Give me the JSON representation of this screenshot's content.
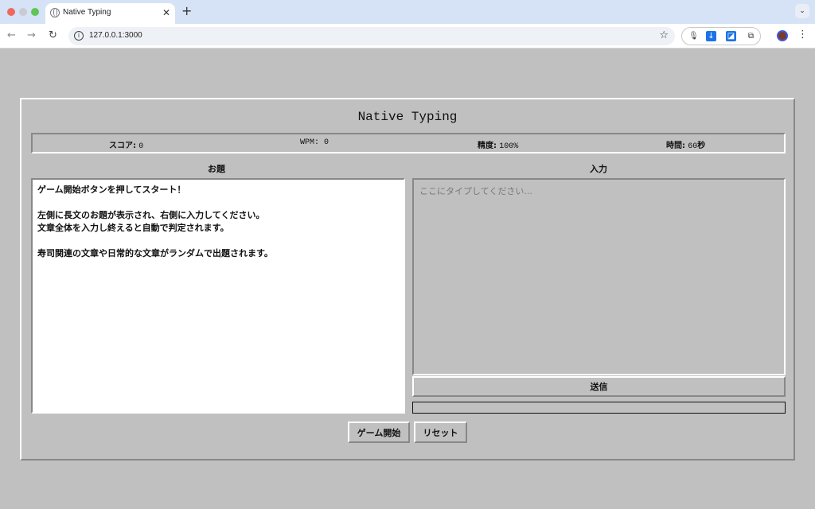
{
  "browser": {
    "tab_title": "Native Typing",
    "url": "127.0.0.1:3000"
  },
  "app": {
    "title": "Native Typing",
    "stats": {
      "score_label": "スコア:",
      "score_value": "0",
      "wpm_label": "WPM:",
      "wpm_value": "0",
      "accuracy_label": "精度:",
      "accuracy_value": "100%",
      "time_label": "時間:",
      "time_value": "60",
      "time_unit": "秒"
    },
    "prompt_heading": "お題",
    "input_heading": "入力",
    "prompt_lines": [
      "ゲーム開始ボタンを押してスタート！",
      "",
      "左側に長文のお題が表示され、右側に入力してください。",
      "文章全体を入力し終えると自動で判定されます。",
      "",
      "寿司関連の文章や日常的な文章がランダムで出題されます。"
    ],
    "input_placeholder": "ここにタイプしてください...",
    "input_value": "",
    "submit_label": "送信",
    "progress": 0,
    "start_label": "ゲーム開始",
    "reset_label": "リセット"
  }
}
